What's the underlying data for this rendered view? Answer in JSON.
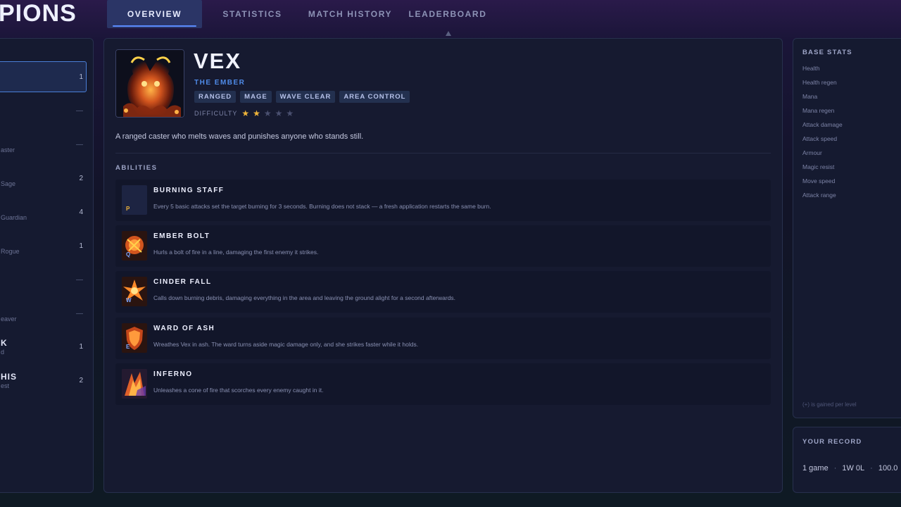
{
  "header": {
    "brand": "PIONS",
    "tabs": [
      {
        "label": "OVERVIEW",
        "active": true
      },
      {
        "label": "STATISTICS",
        "active": false
      },
      {
        "label": "MATCH HISTORY",
        "active": false
      },
      {
        "label": "LEADERBOARD",
        "active": false
      }
    ]
  },
  "left_list": {
    "rows": [
      {
        "count": "1",
        "sub": "",
        "name": ""
      },
      {
        "count": "—",
        "sub": "",
        "name": ""
      },
      {
        "count": "—",
        "sub": "aster",
        "name": ""
      },
      {
        "count": "2",
        "sub": "Sage",
        "name": ""
      },
      {
        "count": "4",
        "sub": "Guardian",
        "name": ""
      },
      {
        "count": "1",
        "sub": "Rogue",
        "name": ""
      },
      {
        "count": "—",
        "sub": "",
        "name": ""
      },
      {
        "count": "—",
        "sub": "eaver",
        "name": ""
      },
      {
        "count": "1",
        "sub": "d",
        "name": "K"
      },
      {
        "count": "2",
        "sub": "est",
        "name": "HIS"
      }
    ]
  },
  "champion": {
    "name": "VEX",
    "title": "THE EMBER",
    "tags": [
      "RANGED",
      "MAGE",
      "WAVE CLEAR",
      "AREA CONTROL"
    ],
    "difficulty_label": "DIFFICULTY",
    "difficulty": 2,
    "difficulty_max": 5,
    "description": "A ranged caster who melts waves and punishes anyone who stands still."
  },
  "abilities_title": "ABILITIES",
  "abilities": [
    {
      "key": "P",
      "name": "BURNING STAFF",
      "desc": "Every 5 basic attacks set the target burning for 3 seconds. Burning does not stack — a fresh application restarts the same burn."
    },
    {
      "key": "Q",
      "name": "EMBER BOLT",
      "desc": "Hurls a bolt of fire in a line, damaging the first enemy it strikes."
    },
    {
      "key": "W",
      "name": "CINDER FALL",
      "desc": "Calls down burning debris, damaging everything in the area and leaving the ground alight for a second afterwards."
    },
    {
      "key": "E",
      "name": "WARD OF ASH",
      "desc": "Wreathes Vex in ash. The ward turns aside magic damage only, and she strikes faster while it holds."
    },
    {
      "key": "R",
      "name": "INFERNO",
      "desc": "Unleashes a cone of fire that scorches every enemy caught in it."
    }
  ],
  "base_stats": {
    "title": "BASE STATS",
    "items": [
      "Health",
      "Health regen",
      "Mana",
      "Mana regen",
      "Attack damage",
      "Attack speed",
      "Armour",
      "Magic resist",
      "Move speed",
      "Attack range"
    ],
    "note": "(+) is gained per level"
  },
  "record": {
    "title": "YOUR RECORD",
    "games": "1 game",
    "wl": "1W 0L",
    "winrate": "100.0"
  },
  "colors": {
    "accent": "#4f8be8",
    "star": "#f0b53a",
    "panel": "#151a30"
  }
}
